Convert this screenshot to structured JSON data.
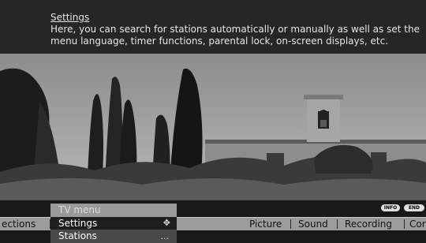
{
  "help": {
    "title": "Settings",
    "text": "Here, you can search for stations automatically or manually as well as set the menu language, timer functions, parental lock, on-screen displays, etc."
  },
  "buttons": {
    "info": "INFO",
    "end": "END"
  },
  "menu_bar": {
    "items": [
      "ections",
      "Picture",
      "Sound",
      "Recording",
      "Cor"
    ]
  },
  "dropdown": {
    "header": "TV menu",
    "selected": "Settings",
    "next": "Stations",
    "selected_icon": "✥",
    "next_icon": "..."
  }
}
